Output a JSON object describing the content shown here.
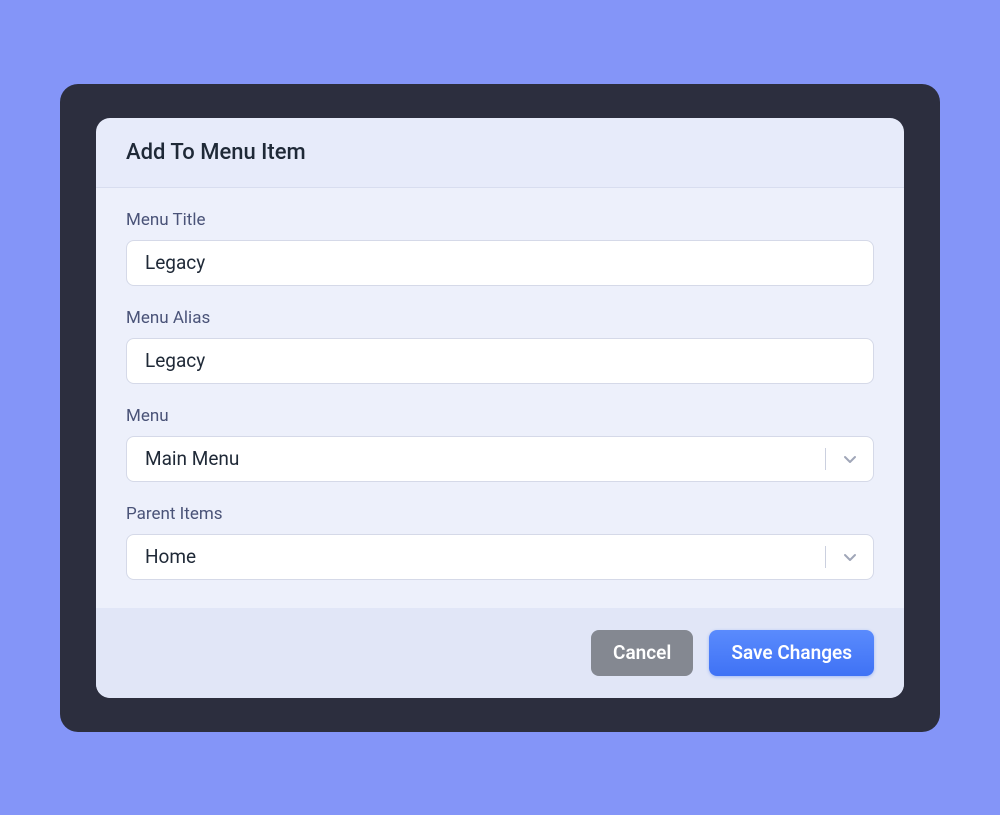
{
  "modal": {
    "title": "Add To Menu Item",
    "fields": {
      "menu_title": {
        "label": "Menu Title",
        "value": "Legacy"
      },
      "menu_alias": {
        "label": "Menu Alias",
        "value": "Legacy"
      },
      "menu": {
        "label": "Menu",
        "selected": "Main Menu"
      },
      "parent_items": {
        "label": "Parent Items",
        "selected": "Home"
      }
    },
    "footer": {
      "cancel_label": "Cancel",
      "save_label": "Save Changes"
    }
  }
}
